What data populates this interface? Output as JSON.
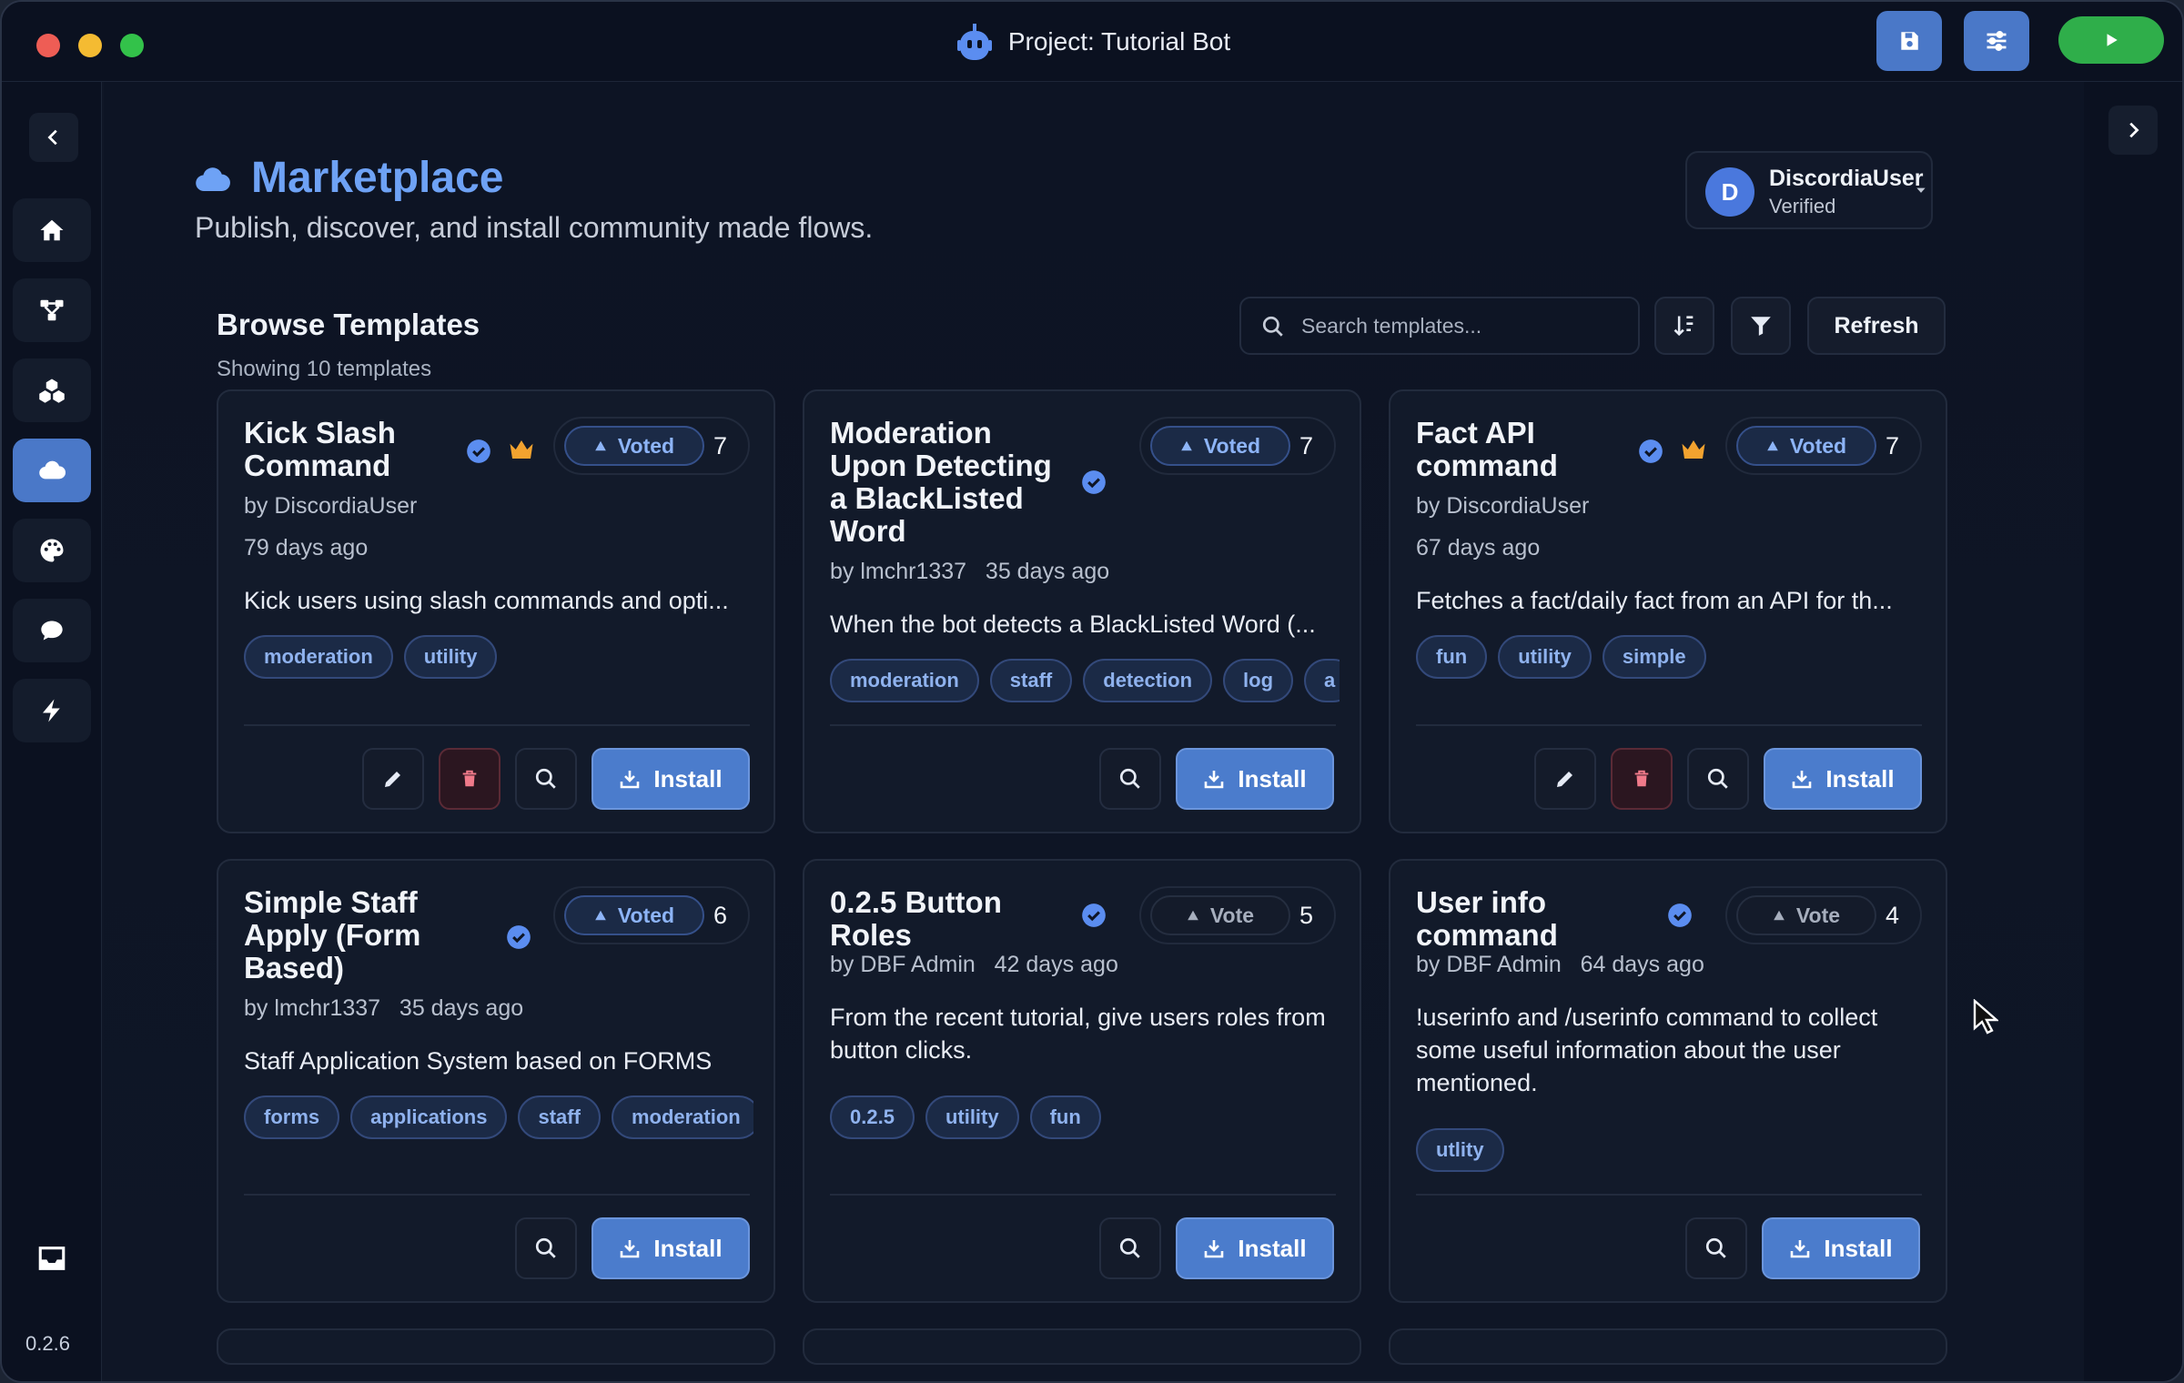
{
  "window": {
    "title": "Project: Tutorial Bot",
    "colors": {
      "close": "#ee5d55",
      "minimize": "#f4bb32",
      "maximize": "#33c24a",
      "accent": "#4a78c8",
      "play": "#2fae4a"
    }
  },
  "sidebar": {
    "items": [
      {
        "name": "home-icon"
      },
      {
        "name": "flow-icon"
      },
      {
        "name": "modules-icon"
      },
      {
        "name": "cloud-icon",
        "active": true
      },
      {
        "name": "palette-icon"
      },
      {
        "name": "chat-icon"
      },
      {
        "name": "lightning-icon"
      }
    ],
    "version": "0.2.6"
  },
  "header": {
    "title": "Marketplace",
    "subtitle": "Publish, discover, and install community made flows."
  },
  "user": {
    "initial": "D",
    "name": "DiscordiaUser",
    "status": "Verified"
  },
  "toolbar": {
    "heading": "Browse Templates",
    "count_text": "Showing 10 templates",
    "search_placeholder": "Search templates...",
    "refresh_label": "Refresh"
  },
  "install_label": "Install",
  "cards": [
    {
      "title": "Kick Slash Command",
      "crown": true,
      "vote_label": "Voted",
      "votes": "7",
      "author": "by DiscordiaUser",
      "age": "79 days ago",
      "description": "Kick users using slash commands and opti...",
      "tags": [
        "moderation",
        "utility"
      ]
    },
    {
      "title": "Moderation Upon Detecting a BlackListed Word",
      "crown": false,
      "vote_label": "Voted",
      "votes": "7",
      "author": "by lmchr1337",
      "age": "35 days ago",
      "description": "When the bot detects a BlackListed Word (...",
      "tags": [
        "moderation",
        "staff",
        "detection",
        "log",
        "a"
      ]
    },
    {
      "title": "Fact API command",
      "crown": true,
      "vote_label": "Voted",
      "votes": "7",
      "author": "by DiscordiaUser",
      "age": "67 days ago",
      "description": "Fetches a fact/daily fact from an API for th...",
      "tags": [
        "fun",
        "utility",
        "simple"
      ]
    },
    {
      "title": "Simple Staff Apply (Form Based)",
      "crown": false,
      "vote_label": "Voted",
      "votes": "6",
      "author": "by lmchr1337",
      "age": "35 days ago",
      "description": "Staff Application System based on FORMS",
      "tags": [
        "forms",
        "applications",
        "staff",
        "moderation"
      ]
    },
    {
      "title": "0.2.5 Button Roles",
      "crown": false,
      "vote_label": "Vote",
      "votes": "5",
      "author": "by DBF Admin",
      "age": "42 days ago",
      "description": "From the recent tutorial, give users roles from button clicks.",
      "tags": [
        "0.2.5",
        "utility",
        "fun"
      ]
    },
    {
      "title": "User info command",
      "crown": false,
      "vote_label": "Vote",
      "votes": "4",
      "author": "by DBF Admin",
      "age": "64 days ago",
      "description": "!userinfo and /userinfo command to collect some useful information about the user mentioned.",
      "tags": [
        "utlity"
      ]
    }
  ]
}
